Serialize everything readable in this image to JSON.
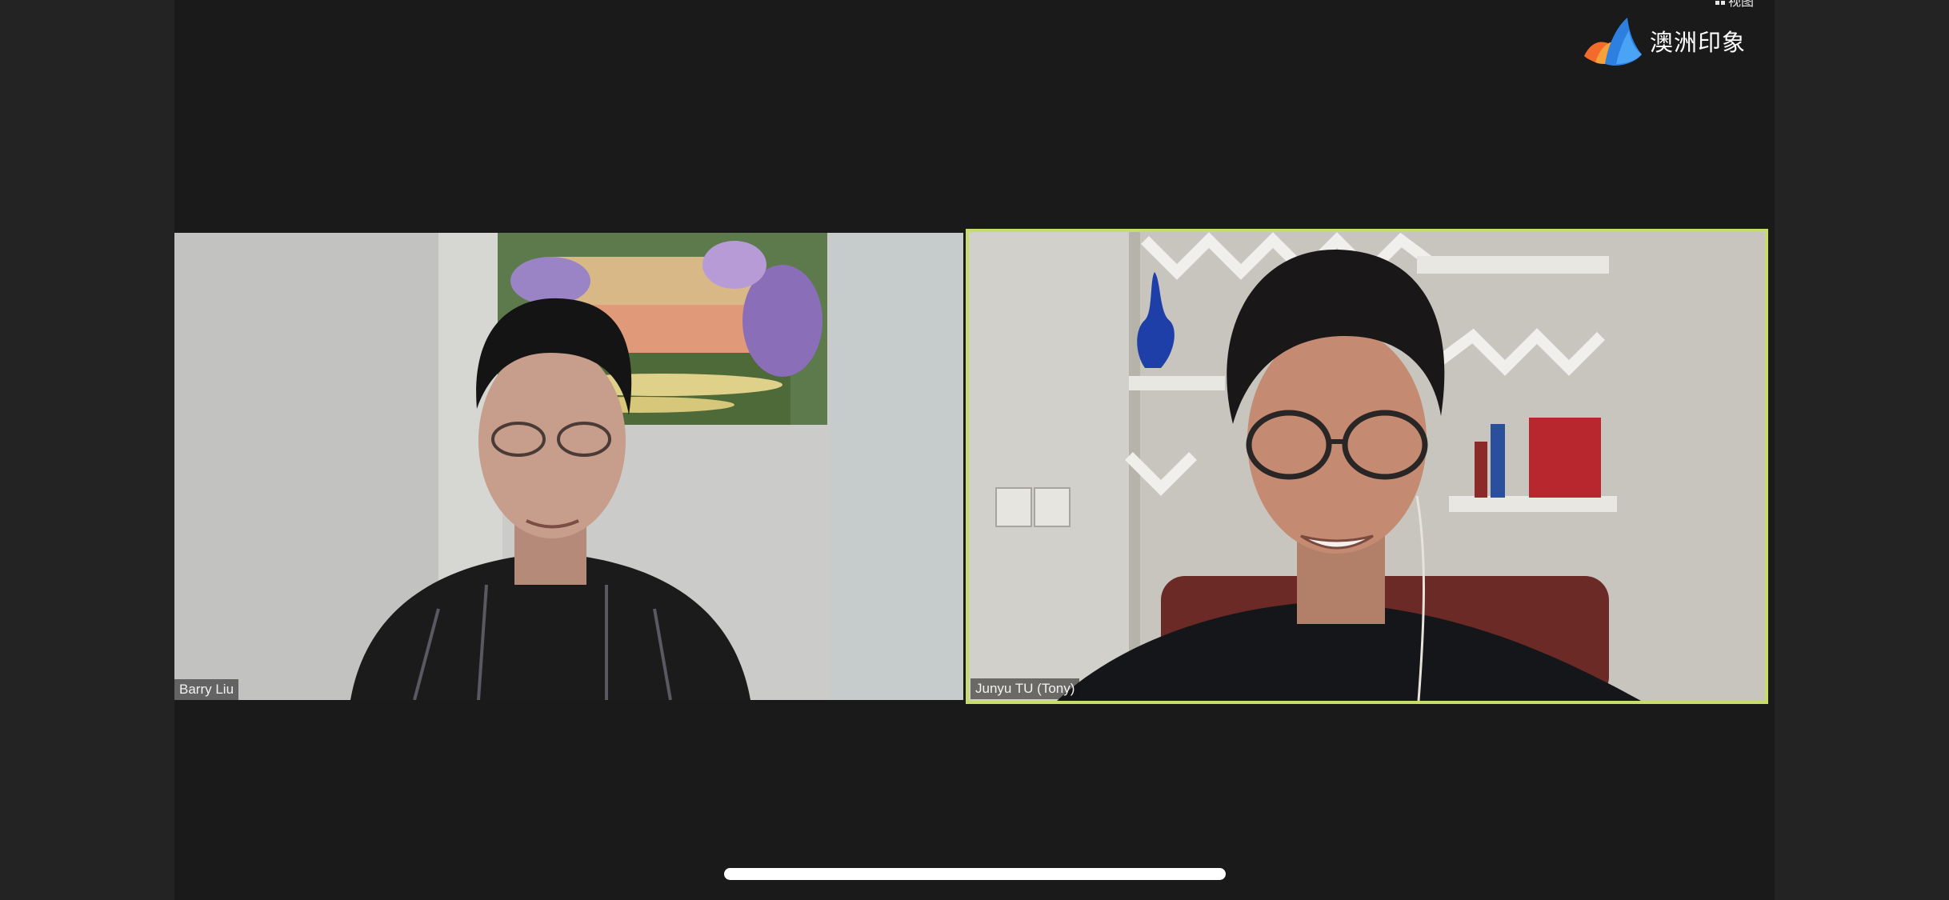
{
  "app": {
    "view_label": "视图",
    "watermark_text": "澳洲印象",
    "accent_border_color": "#c7dd6b"
  },
  "participants": [
    {
      "name": "Barry Liu",
      "active_speaker": false
    },
    {
      "name": "Junyu TU (Tony)",
      "active_speaker": true
    }
  ],
  "icons": {
    "view": "grid-icon",
    "logo": "wing-logo-icon"
  }
}
